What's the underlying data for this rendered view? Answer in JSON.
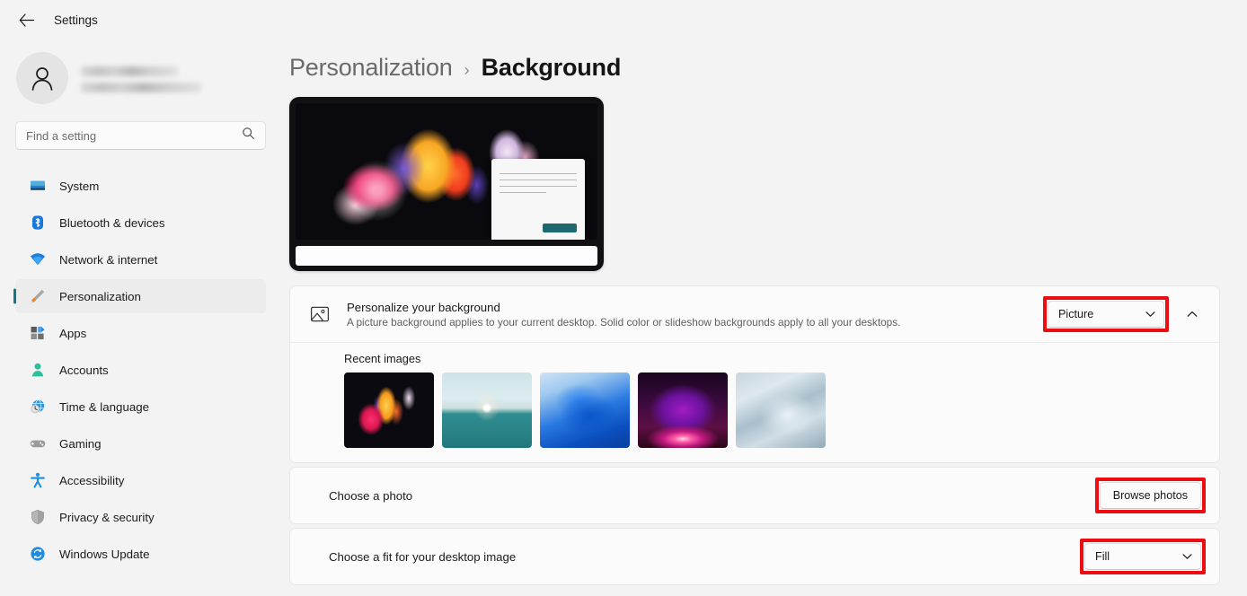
{
  "window": {
    "app_title": "Settings",
    "back_icon": "back-arrow-icon"
  },
  "sidebar": {
    "account": {
      "name_redacted": "",
      "email_redacted": "",
      "avatar_icon": "person-avatar-icon"
    },
    "search": {
      "placeholder": "Find a setting",
      "icon": "search-icon"
    },
    "items": [
      {
        "label": "System",
        "icon": "system-monitor-icon",
        "selected": false
      },
      {
        "label": "Bluetooth & devices",
        "icon": "bluetooth-icon",
        "selected": false
      },
      {
        "label": "Network & internet",
        "icon": "wifi-icon",
        "selected": false
      },
      {
        "label": "Personalization",
        "icon": "paintbrush-icon",
        "selected": true
      },
      {
        "label": "Apps",
        "icon": "apps-grid-icon",
        "selected": false
      },
      {
        "label": "Accounts",
        "icon": "person-icon",
        "selected": false
      },
      {
        "label": "Time & language",
        "icon": "globe-clock-icon",
        "selected": false
      },
      {
        "label": "Gaming",
        "icon": "gamepad-icon",
        "selected": false
      },
      {
        "label": "Accessibility",
        "icon": "accessibility-person-icon",
        "selected": false
      },
      {
        "label": "Privacy & security",
        "icon": "shield-icon",
        "selected": false
      },
      {
        "label": "Windows Update",
        "icon": "update-refresh-icon",
        "selected": false
      }
    ]
  },
  "main": {
    "breadcrumb": {
      "parent": "Personalization",
      "separator": "›",
      "current": "Background"
    },
    "preview": {
      "name": "desktop-preview",
      "wallpaper_name": "bloom-wallpaper"
    },
    "rows": {
      "personalize": {
        "icon": "picture-icon",
        "title": "Personalize your background",
        "subtitle": "A picture background applies to your current desktop. Solid color or slideshow backgrounds apply to all your desktops.",
        "dropdown_value": "Picture",
        "dropdown_chevron": "chevron-down-icon",
        "expander_chevron": "chevron-up-icon",
        "highlighted": true
      },
      "recent": {
        "label": "Recent images",
        "thumbnails": [
          {
            "name": "bloom-thumbnail",
            "selected": true
          },
          {
            "name": "sunset-sea-thumbnail",
            "selected": false
          },
          {
            "name": "blue-abstract-thumbnail",
            "selected": false
          },
          {
            "name": "purple-glow-thumbnail",
            "selected": false
          },
          {
            "name": "light-ruffles-thumbnail",
            "selected": false
          }
        ]
      },
      "choose_photo": {
        "title": "Choose a photo",
        "button_label": "Browse photos",
        "highlighted": true
      },
      "choose_fit": {
        "title": "Choose a fit for your desktop image",
        "dropdown_value": "Fill",
        "dropdown_chevron": "chevron-down-icon",
        "highlighted": true
      }
    }
  },
  "colors": {
    "annotation_red": "#ec0c12",
    "accent_teal": "#0f7a83",
    "page_bg": "#f3f3f3",
    "card_bg": "#fbfbfb"
  }
}
